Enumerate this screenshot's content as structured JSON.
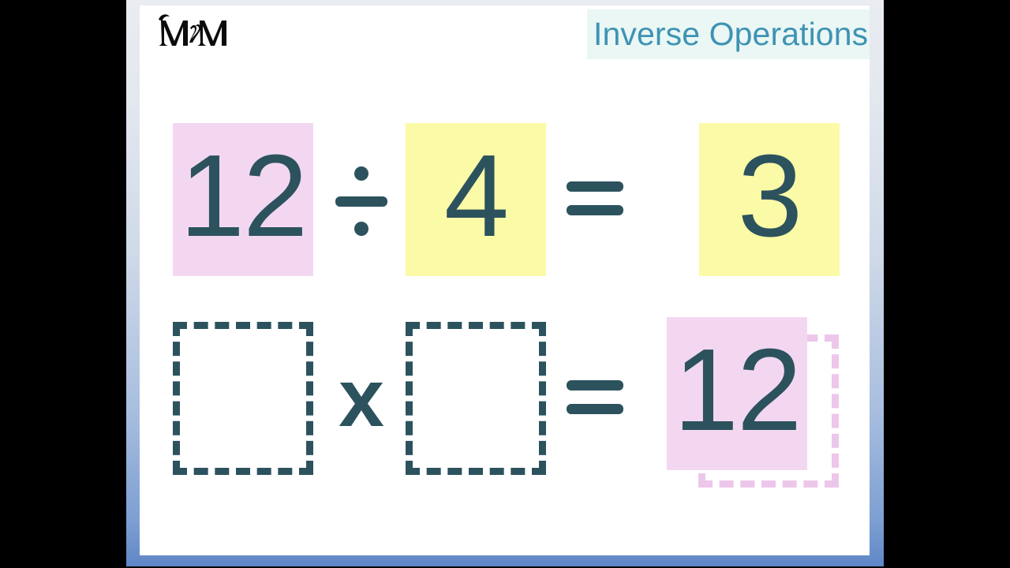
{
  "slide": {
    "logo_name": "maths-with-mum-monogram",
    "logo_text": "MᵂM",
    "title": "Inverse Operations",
    "title_color": "#3e93b4",
    "title_band_color": "#eaf7f4",
    "background_color": "#ffffff"
  },
  "palette": {
    "ink": "#2c525e",
    "pink_fill": "#f3d7f0",
    "pink_outline": "#edc7ea",
    "yellow_fill": "#fbfaa7",
    "letterbox": "#000000"
  },
  "equations": [
    {
      "id": "division-row",
      "cells": [
        {
          "kind": "value-box",
          "name": "dividend-box",
          "value": "12",
          "fill": "pink"
        },
        {
          "kind": "operator",
          "name": "divide-operator",
          "symbol": "÷"
        },
        {
          "kind": "value-box",
          "name": "divisor-box",
          "value": "4",
          "fill": "yellow"
        },
        {
          "kind": "operator",
          "name": "equals-operator",
          "symbol": "="
        },
        {
          "kind": "value-box",
          "name": "quotient-box",
          "value": "3",
          "fill": "yellow"
        }
      ]
    },
    {
      "id": "multiplication-row",
      "cells": [
        {
          "kind": "blank-box",
          "name": "factor-one-blank",
          "value": "",
          "fill": "none"
        },
        {
          "kind": "operator",
          "name": "multiply-operator",
          "symbol": "x"
        },
        {
          "kind": "blank-box",
          "name": "factor-two-blank",
          "value": "",
          "fill": "none"
        },
        {
          "kind": "operator",
          "name": "equals-operator",
          "symbol": "="
        },
        {
          "kind": "drop-target",
          "name": "product-drop-target",
          "value": "12",
          "fill": "pink"
        }
      ]
    }
  ]
}
